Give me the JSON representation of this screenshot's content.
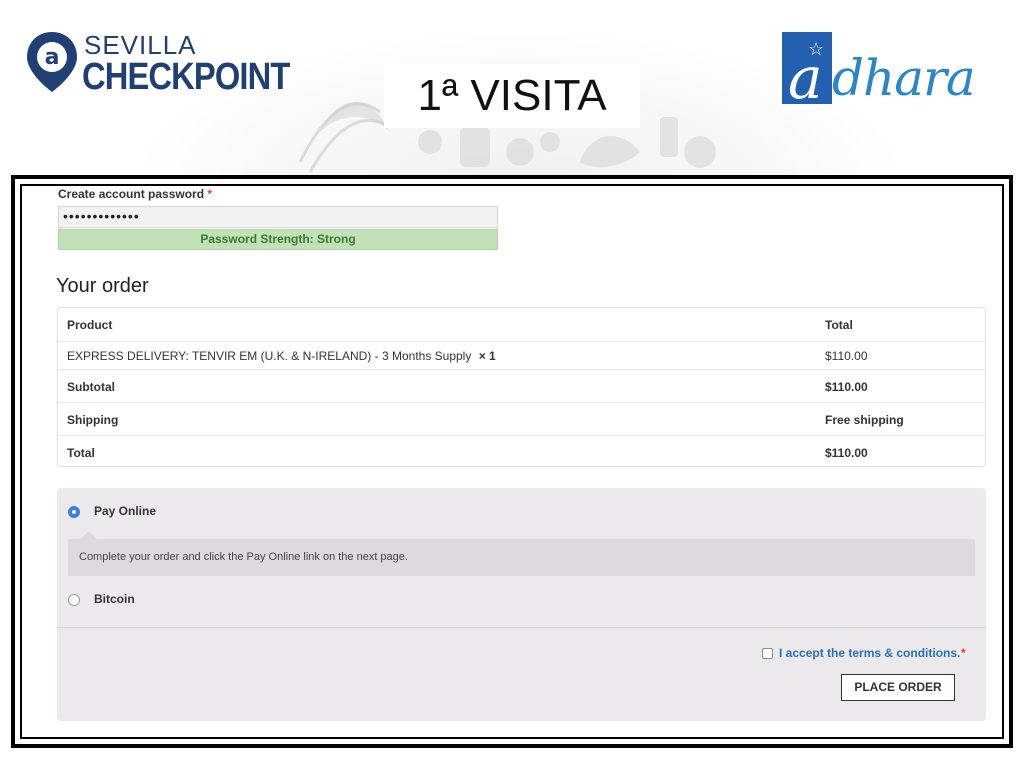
{
  "slide": {
    "title": "1ª VISITA"
  },
  "logos": {
    "left": {
      "line1": "SEVILLA",
      "line2": "CHECKPOINT"
    },
    "right": {
      "initial": "a",
      "text": "dhara"
    }
  },
  "account": {
    "password_label": "Create account password",
    "required_mark": "*",
    "password_value": "•••••••••••••",
    "strength_text": "Password Strength: Strong"
  },
  "order": {
    "heading": "Your order",
    "header": {
      "product": "Product",
      "total": "Total"
    },
    "items": [
      {
        "product": "EXPRESS DELIVERY: TENVIR EM (U.K. & N-IRELAND) - 3 Months Supply",
        "qty": "× 1",
        "total": "$110.00"
      }
    ],
    "subtotal_label": "Subtotal",
    "subtotal_value": "$110.00",
    "shipping_label": "Shipping",
    "shipping_value": "Free shipping",
    "total_label": "Total",
    "total_value": "$110.00"
  },
  "payment": {
    "methods": [
      {
        "label": "Pay Online",
        "selected": true,
        "description": "Complete your order and click the Pay Online link on the next page."
      },
      {
        "label": "Bitcoin",
        "selected": false
      }
    ],
    "terms_text": "I accept the terms & conditions.",
    "terms_required": "*",
    "place_order_label": "PLACE ORDER"
  },
  "colors": {
    "brand_dark_blue": "#1f3f75",
    "brand_light_blue": "#2a87c7",
    "strength_bg": "#c1e1b9",
    "strength_text": "#3a7a30",
    "link_blue": "#2a70b8",
    "required_red": "#e2401c",
    "radio_selected": "#3b82d6"
  }
}
